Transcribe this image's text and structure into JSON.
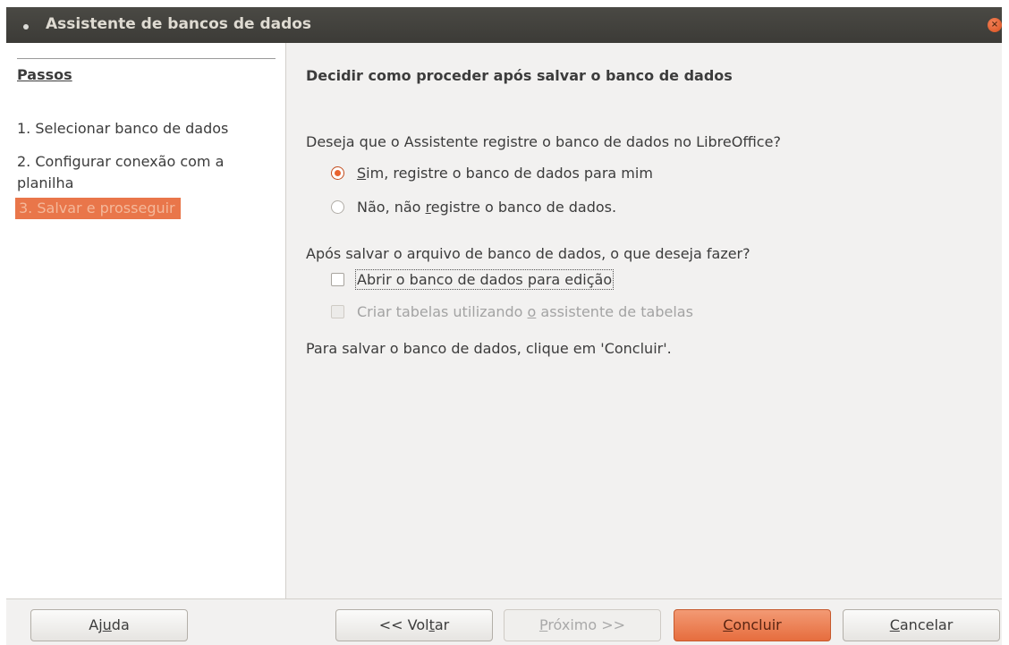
{
  "window": {
    "title": "Assistente de bancos de dados",
    "close_glyph": "×"
  },
  "sidebar": {
    "title": "Passos",
    "steps": [
      {
        "label": "1. Selecionar banco de dados"
      },
      {
        "label": "2. Configurar conexão com a planilha"
      },
      {
        "label": "3. Salvar e prosseguir",
        "active": true
      }
    ]
  },
  "main": {
    "title": "Decidir como proceder após salvar o banco de dados",
    "register_question": "Deseja que o Assistente registre o banco de dados no LibreOffice?",
    "register_yes": {
      "label_pre": "",
      "mnemonic": "S",
      "label_post": "im, registre o banco de dados para mim",
      "checked": true
    },
    "register_no": {
      "label_pre": "Não, não ",
      "mnemonic": "r",
      "label_post": "egistre o banco de dados.",
      "checked": false
    },
    "after_question": "Após salvar o arquivo de banco de dados, o que deseja fazer?",
    "open_for_edit": {
      "label": "Abrir o banco de dados para edição",
      "checked": false
    },
    "create_tables": {
      "label_pre": "Criar tabelas utilizando ",
      "mnemonic": "o",
      "label_post": " assistente de tabelas",
      "checked": false,
      "disabled": true
    },
    "finish_note": "Para salvar o banco de dados, clique em 'Concluir'."
  },
  "footer": {
    "help": {
      "pre": "Aj",
      "mnemonic": "u",
      "post": "da"
    },
    "back": {
      "pre": "<< Vol",
      "mnemonic": "t",
      "post": "ar"
    },
    "next": {
      "pre": "",
      "mnemonic": "P",
      "post": "róximo >>"
    },
    "finish": {
      "pre": "",
      "mnemonic": "C",
      "post": "oncluir"
    },
    "cancel": {
      "pre": "",
      "mnemonic": "C",
      "post": "ancelar"
    }
  },
  "colors": {
    "accent": "#e9632f",
    "titlebar": "#3c3b37",
    "active_step_bg": "#e9764a"
  },
  "icons": {
    "close": "close-icon",
    "window_menu": "window-menu-dot-icon"
  }
}
